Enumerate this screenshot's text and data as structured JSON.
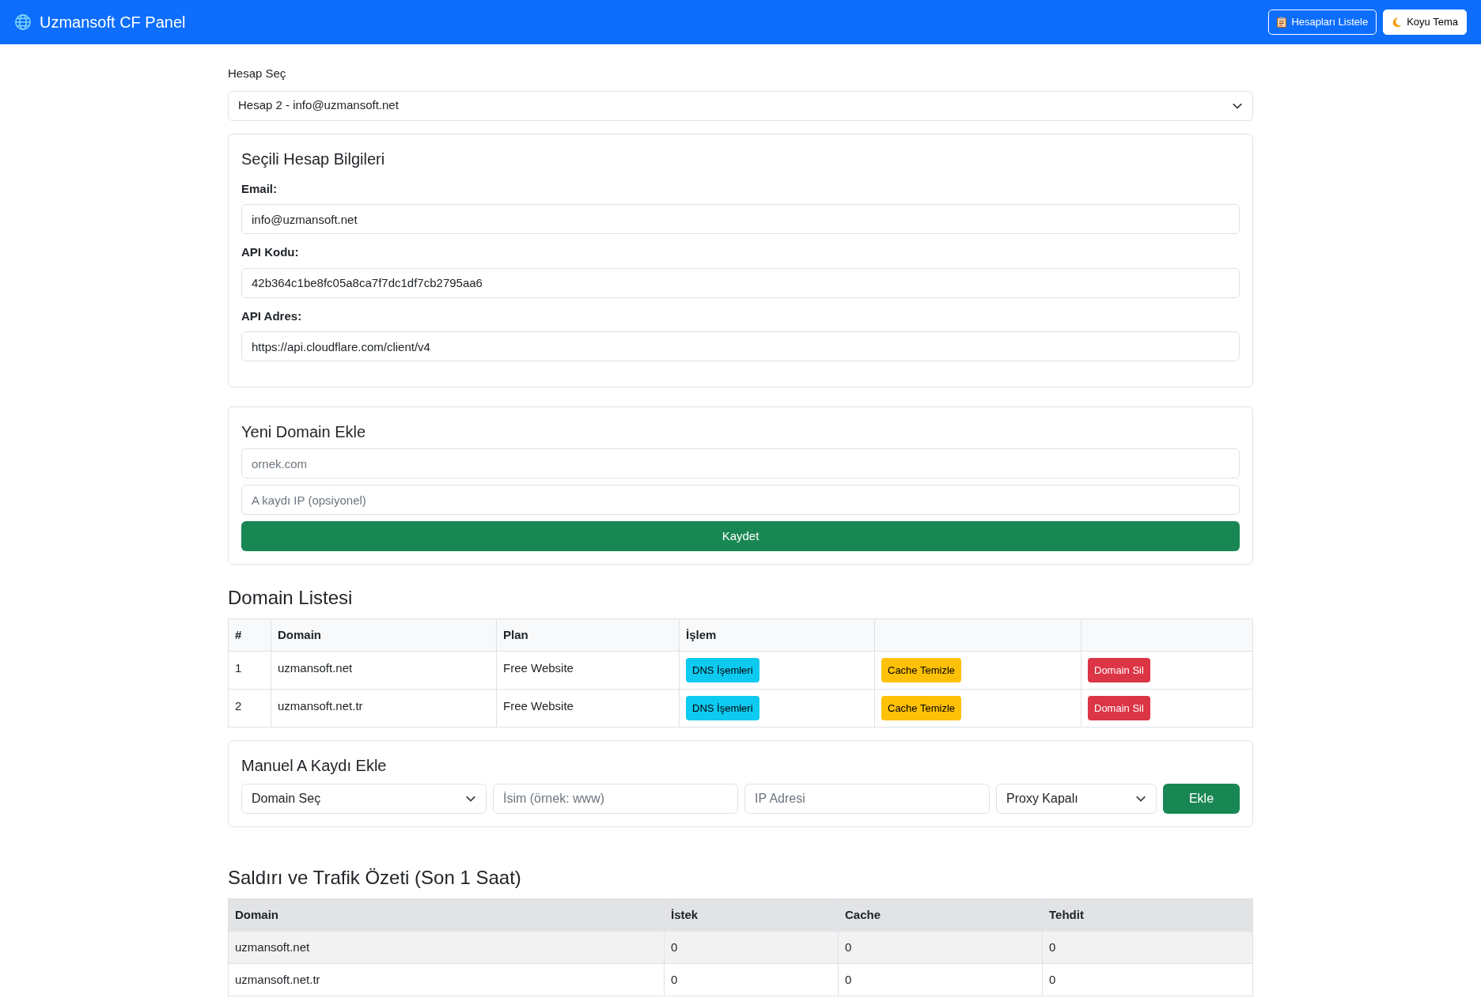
{
  "navbar": {
    "brand": "Uzmansoft CF Panel",
    "buttons": [
      {
        "label": "Hesapları Listele",
        "kind": "outline"
      },
      {
        "label": "Koyu Tema",
        "kind": "light"
      }
    ]
  },
  "account_select": {
    "label": "Hesap Seç",
    "value": "Hesap 2 - info@uzmansoft.net"
  },
  "account_info": {
    "title": "Seçili Hesap Bilgileri",
    "fields": [
      {
        "label": "Email:",
        "value": "info@uzmansoft.net"
      },
      {
        "label": "API Kodu:",
        "value": "42b364c1be8fc05a8ca7f7dc1df7cb2795aa6"
      },
      {
        "label": "API Adres:",
        "value": "https://api.cloudflare.com/client/v4"
      }
    ]
  },
  "new_domain": {
    "title": "Yeni Domain Ekle",
    "inputs": [
      {
        "placeholder": "ornek.com"
      },
      {
        "placeholder": "A kaydı IP (opsiyonel)"
      }
    ],
    "button": "Kaydet"
  },
  "domain_list": {
    "title": "Domain Listesi",
    "columns": [
      "#",
      "Domain",
      "Plan",
      "İşlem"
    ],
    "rows": [
      {
        "index": "1",
        "domain": "uzmansoft.net",
        "plan": "Free Website",
        "actions": [
          {
            "label": "DNS İşemleri",
            "kind": "info"
          },
          {
            "label": "Cache Temizle",
            "kind": "warning"
          },
          {
            "label": "Domain Sil",
            "kind": "danger"
          }
        ]
      },
      {
        "index": "2",
        "domain": "uzmansoft.net.tr",
        "plan": "Free Website",
        "actions": [
          {
            "label": "DNS İşemleri",
            "kind": "info"
          },
          {
            "label": "Cache Temizle",
            "kind": "warning"
          },
          {
            "label": "Domain Sil",
            "kind": "danger"
          }
        ]
      }
    ]
  },
  "manual_record": {
    "title": "Manuel A Kaydı Ekle",
    "domain_select": "Domain Seç",
    "name_placeholder": "İsim (örnek: www)",
    "ip_placeholder": "IP Adresi",
    "proxy_select": "Proxy Kapalı",
    "button": "Ekle"
  },
  "traffic": {
    "title": "Saldırı ve Trafik Özeti (Son 1 Saat)",
    "columns": [
      "Domain",
      "İstek",
      "Cache",
      "Tehdit"
    ],
    "rows": [
      [
        "uzmansoft.net",
        "0",
        "0",
        "0"
      ],
      [
        "uzmansoft.net.tr",
        "0",
        "0",
        "0"
      ]
    ]
  }
}
